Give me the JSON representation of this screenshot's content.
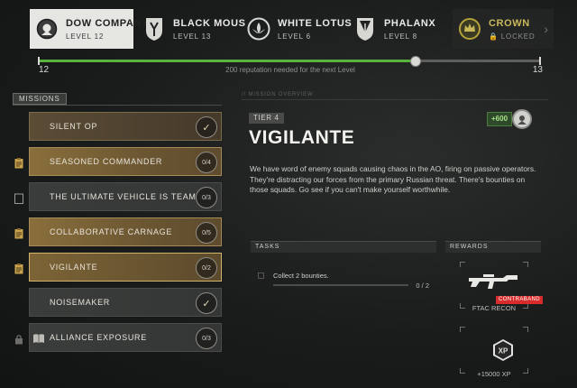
{
  "factions": [
    {
      "name": "DOW COMPANY",
      "level": "LEVEL 12",
      "icon": "dow-company-emblem-icon",
      "state": "active"
    },
    {
      "name": "BLACK MOUS",
      "level": "LEVEL 13",
      "icon": "black-mous-emblem-icon",
      "state": "normal"
    },
    {
      "name": "WHITE LOTUS",
      "level": "LEVEL 6",
      "icon": "white-lotus-emblem-icon",
      "state": "normal"
    },
    {
      "name": "PHALANX",
      "level": "LEVEL 8",
      "icon": "phalanx-emblem-icon",
      "state": "normal"
    },
    {
      "name": "CROWN",
      "level": "LOCKED",
      "icon": "crown-emblem-icon",
      "state": "locked"
    }
  ],
  "progress": {
    "current_level": "12",
    "next_level": "13",
    "fraction": 0.75,
    "note": "200 reputation needed for the next Level"
  },
  "missions_label": "MISSIONS",
  "missions": [
    {
      "name": "SILENT OP",
      "status": "✓",
      "state": "done",
      "icon": "none"
    },
    {
      "name": "SEASONED COMMANDER",
      "status": "0/4",
      "state": "active",
      "icon": "clipboard-icon"
    },
    {
      "name": "THE ULTIMATE VEHICLE IS TEAM",
      "status": "0/3",
      "state": "inactive",
      "icon": "clipboard-outline-icon"
    },
    {
      "name": "COLLABORATIVE CARNAGE",
      "status": "0/5",
      "state": "active",
      "icon": "clipboard-icon"
    },
    {
      "name": "VIGILANTE",
      "status": "0/2",
      "state": "selected",
      "icon": "clipboard-icon"
    },
    {
      "name": "NOISEMAKER",
      "status": "✓",
      "state": "inactive",
      "icon": "none"
    },
    {
      "name": "ALLIANCE EXPOSURE",
      "status": "0/3",
      "state": "inactive",
      "icon": "lock-icon"
    }
  ],
  "overview_tag": "// MISSION OVERVIEW",
  "detail": {
    "tier": "TIER 4",
    "title": "VIGILANTE",
    "xp_chip": "+600",
    "description": "We have word of enemy squads causing chaos in the AO, firing on passive operators. They're distracting our forces from the primary Russian threat. There's bounties on those squads. Go see if you can't make yourself worthwhile."
  },
  "tasks": {
    "label": "TASKS",
    "items": [
      {
        "text": "Collect 2 bounties.",
        "progress": "0 / 2"
      }
    ]
  },
  "rewards": {
    "label": "REWARDS",
    "items": [
      {
        "name": "FTAC RECON",
        "tag": "CONTRABAND",
        "icon": "rifle-icon"
      },
      {
        "name": "+15000 XP",
        "icon": "xp-icon"
      }
    ]
  },
  "colors": {
    "progress_fill": "#5bb23d",
    "contraband": "#d82b2b",
    "xp_chip": "#a7e087",
    "locked": "#c9b85a"
  }
}
